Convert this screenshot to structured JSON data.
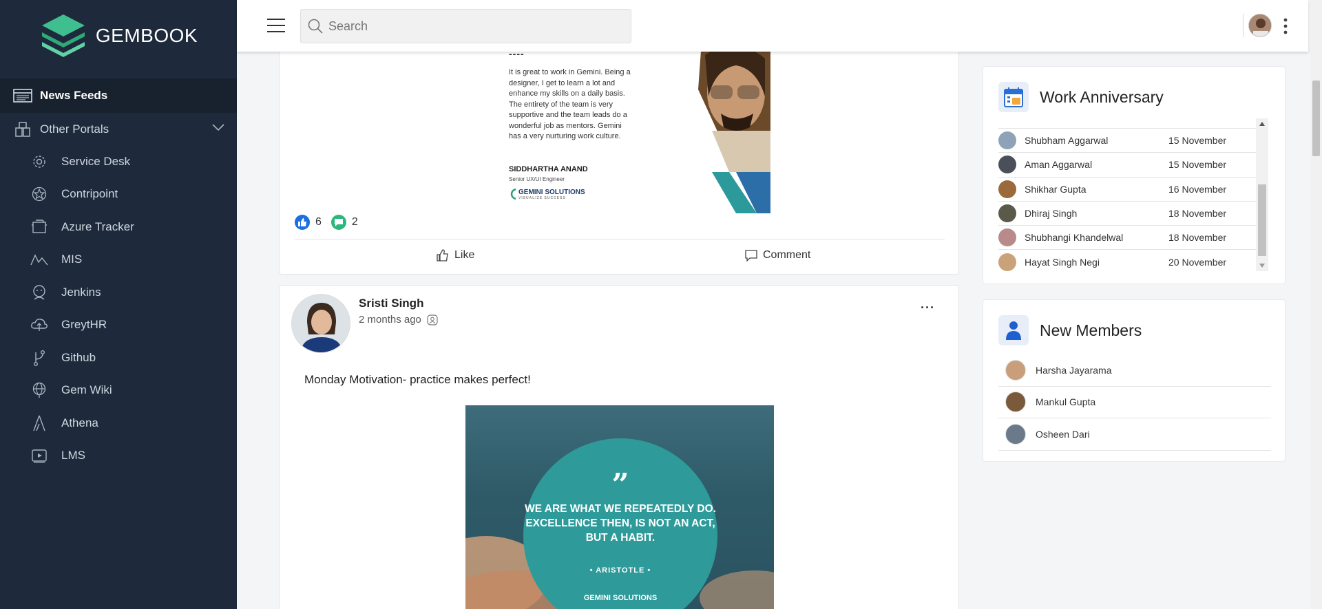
{
  "brand": {
    "name": "GEMBOOK"
  },
  "sidebar": {
    "active": {
      "label": "News Feeds",
      "icon": "news-feed-icon"
    },
    "group": {
      "label": "Other Portals",
      "icon": "portals-icon"
    },
    "items": [
      {
        "label": "Service Desk",
        "icon": "gear-icon"
      },
      {
        "label": "Contripoint",
        "icon": "star-badge-icon"
      },
      {
        "label": "Azure Tracker",
        "icon": "tracker-icon"
      },
      {
        "label": "MIS",
        "icon": "chart-wave-icon"
      },
      {
        "label": "Jenkins",
        "icon": "jenkins-icon"
      },
      {
        "label": "GreytHR",
        "icon": "cloud-hr-icon"
      },
      {
        "label": "Github",
        "icon": "git-branch-icon"
      },
      {
        "label": "Gem Wiki",
        "icon": "globe-icon"
      },
      {
        "label": "Athena",
        "icon": "athena-icon"
      },
      {
        "label": "LMS",
        "icon": "video-icon"
      }
    ]
  },
  "header": {
    "search_placeholder": "Search"
  },
  "post1": {
    "quote_dash": "----",
    "quote_text": "It is great to work in Gemini. Being a designer, I get to learn a lot and enhance my skills on a daily basis. The entirety of the team is very supportive and the team leads do a wonderful job as mentors. Gemini has a very nurturing work culture.",
    "quote_name": "SIDDHARTHA ANAND",
    "quote_role": "Senior UX/UI Engineer",
    "logo_text": "GEMINI SOLUTIONS",
    "logo_tagline": "VISUALIZE SUCCESS",
    "likes": "6",
    "comments": "2",
    "like_label": "Like",
    "comment_label": "Comment"
  },
  "post2": {
    "author": "Sristi Singh",
    "time": "2 months ago",
    "more": "···",
    "text": "Monday Motivation- practice makes perfect!",
    "image_quote": "WE ARE WHAT WE REPEATEDLY DO. EXCELLENCE THEN, IS NOT AN ACT, BUT A HABIT.",
    "image_author": "• ARISTOTLE •",
    "image_logo": "GEMINI SOLUTIONS"
  },
  "work_anniversary": {
    "title": "Work Anniversary",
    "rows": [
      {
        "name": "Shubham Aggarwal",
        "date": "15 November",
        "color": "#8fa3b8"
      },
      {
        "name": "Aman Aggarwal",
        "date": "15 November",
        "color": "#4a4f5a"
      },
      {
        "name": "Shikhar Gupta",
        "date": "16 November",
        "color": "#9a6a3a"
      },
      {
        "name": "Dhiraj Singh",
        "date": "18 November",
        "color": "#5a5a4a"
      },
      {
        "name": "Shubhangi Khandelwal",
        "date": "18 November",
        "color": "#b88a8a"
      },
      {
        "name": "Hayat Singh Negi",
        "date": "20 November",
        "color": "#c9a27a"
      }
    ]
  },
  "new_members": {
    "title": "New Members",
    "rows": [
      {
        "name": "Harsha Jayarama",
        "color": "#c89f7a"
      },
      {
        "name": "Mankul Gupta",
        "color": "#7a5a3a"
      },
      {
        "name": "Osheen Dari",
        "color": "#6a7a8a"
      }
    ]
  }
}
